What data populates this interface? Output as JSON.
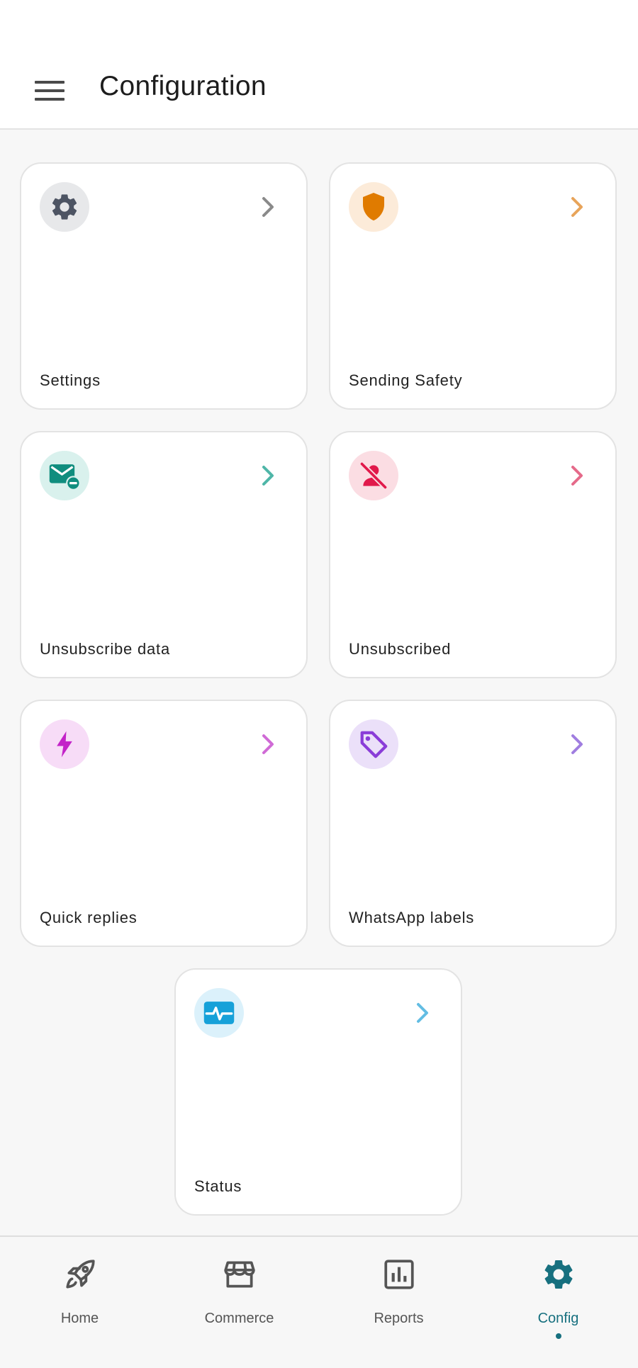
{
  "app_bar": {
    "title": "Configuration",
    "menu_icon": "hamburger-menu-icon"
  },
  "cards": [
    {
      "label": "Settings",
      "icon": "gear-icon",
      "accent": "#4d5463",
      "bg": "#e7e8ea",
      "chevron": "#8a8a8a"
    },
    {
      "label": "Sending Safety",
      "icon": "shield-icon",
      "accent": "#e07b00",
      "bg": "#fcebd9",
      "chevron": "#e8a45a"
    },
    {
      "label": "Unsubscribe data",
      "icon": "mail-minus-icon",
      "accent": "#0f8d7e",
      "bg": "#d9f1ed",
      "chevron": "#4fb6a8"
    },
    {
      "label": "Unsubscribed",
      "icon": "user-off-icon",
      "accent": "#e1194b",
      "bg": "#fbdde3",
      "chevron": "#e56a8a"
    },
    {
      "label": "Quick replies",
      "icon": "lightning-bolt-icon",
      "accent": "#c323c8",
      "bg": "#f7dcf7",
      "chevron": "#d06bd6"
    },
    {
      "label": "WhatsApp labels",
      "icon": "tag-icon",
      "accent": "#8a3cd8",
      "bg": "#ebe0f9",
      "chevron": "#a07ee0"
    },
    {
      "label": "Status",
      "icon": "pulse-monitor-icon",
      "accent": "#16a1d9",
      "bg": "#dbf1fb",
      "chevron": "#63bde3"
    }
  ],
  "bottom_nav": {
    "items": [
      {
        "label": "Home",
        "icon": "rocket-icon"
      },
      {
        "label": "Commerce",
        "icon": "storefront-icon"
      },
      {
        "label": "Reports",
        "icon": "bar-chart-icon"
      },
      {
        "label": "Config",
        "icon": "gear-icon"
      }
    ],
    "active": "Config",
    "active_color": "#17707f"
  }
}
